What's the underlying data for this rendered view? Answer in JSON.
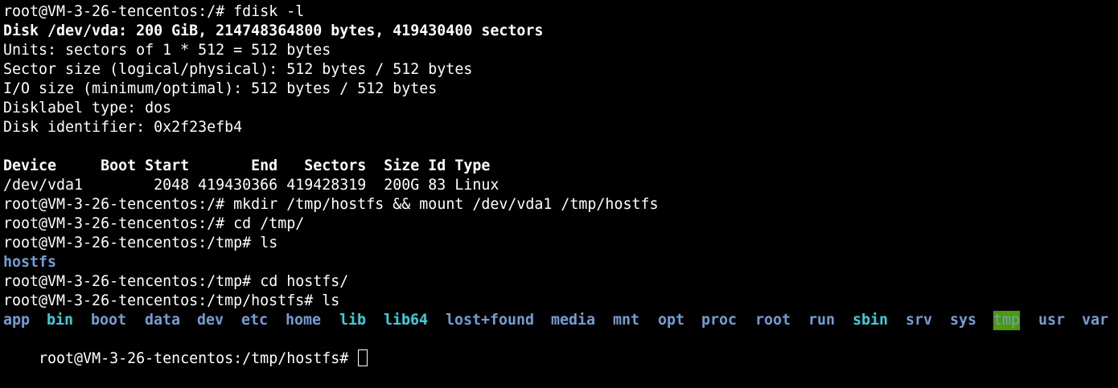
{
  "terminal": {
    "lines": [
      {
        "prompt": "root@VM-3-26-tencentos:/# ",
        "command": "fdisk -l"
      },
      {
        "text": "Disk /dev/vda: 200 GiB, 214748364800 bytes, 419430400 sectors",
        "bold": true
      },
      {
        "text": "Units: sectors of 1 * 512 = 512 bytes"
      },
      {
        "text": "Sector size (logical/physical): 512 bytes / 512 bytes"
      },
      {
        "text": "I/O size (minimum/optimal): 512 bytes / 512 bytes"
      },
      {
        "text": "Disklabel type: dos"
      },
      {
        "text": "Disk identifier: 0x2f23efb4"
      },
      {
        "text": ""
      },
      {
        "text": "Device     Boot Start       End   Sectors  Size Id Type",
        "bold": true
      },
      {
        "text": "/dev/vda1        2048 419430366 419428319  200G 83 Linux"
      },
      {
        "prompt": "root@VM-3-26-tencentos:/# ",
        "command": "mkdir /tmp/hostfs && mount /dev/vda1 /tmp/hostfs"
      },
      {
        "prompt": "root@VM-3-26-tencentos:/# ",
        "command": "cd /tmp/"
      },
      {
        "prompt": "root@VM-3-26-tencentos:/tmp# ",
        "command": "ls"
      },
      {
        "text": "hostfs",
        "kind": "dir"
      },
      {
        "prompt": "root@VM-3-26-tencentos:/tmp# ",
        "command": "cd hostfs/"
      },
      {
        "prompt": "root@VM-3-26-tencentos:/tmp/hostfs# ",
        "command": "ls"
      }
    ],
    "ls_entries": [
      {
        "name": "app",
        "kind": "dir"
      },
      {
        "name": "bin",
        "kind": "link"
      },
      {
        "name": "boot",
        "kind": "dir"
      },
      {
        "name": "data",
        "kind": "dir"
      },
      {
        "name": "dev",
        "kind": "dir"
      },
      {
        "name": "etc",
        "kind": "dir"
      },
      {
        "name": "home",
        "kind": "dir"
      },
      {
        "name": "lib",
        "kind": "link"
      },
      {
        "name": "lib64",
        "kind": "link"
      },
      {
        "name": "lost+found",
        "kind": "dir"
      },
      {
        "name": "media",
        "kind": "dir"
      },
      {
        "name": "mnt",
        "kind": "dir"
      },
      {
        "name": "opt",
        "kind": "dir"
      },
      {
        "name": "proc",
        "kind": "dir"
      },
      {
        "name": "root",
        "kind": "dir"
      },
      {
        "name": "run",
        "kind": "dir"
      },
      {
        "name": "sbin",
        "kind": "link"
      },
      {
        "name": "srv",
        "kind": "dir"
      },
      {
        "name": "sys",
        "kind": "dir"
      },
      {
        "name": "tmp",
        "kind": "sticky"
      },
      {
        "name": "usr",
        "kind": "dir"
      },
      {
        "name": "var",
        "kind": "dir"
      }
    ],
    "final_prompt": "root@VM-3-26-tencentos:/tmp/hostfs# ",
    "colors": {
      "background": "#000000",
      "foreground": "#ffffff",
      "directory": "#6f9fd8",
      "symlink": "#29d6e0",
      "sticky_bg": "#4e9a06"
    }
  }
}
